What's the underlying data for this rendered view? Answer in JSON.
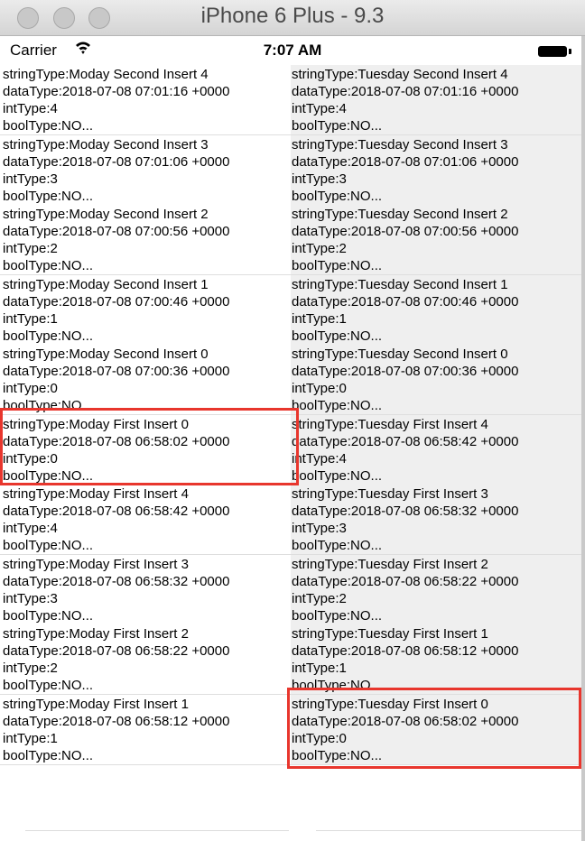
{
  "window": {
    "title": "iPhone 6 Plus - 9.3"
  },
  "statusbar": {
    "carrier": "Carrier",
    "time": "7:07 AM"
  },
  "left_column": [
    {
      "stringType": "stringType:Moday Second Insert 4",
      "dataType": "dataType:2018-07-08 07:01:16 +0000",
      "intType": "intType:4",
      "boolType": "boolType:NO..."
    },
    {
      "stringType": "stringType:Moday Second Insert 3",
      "dataType": "dataType:2018-07-08 07:01:06 +0000",
      "intType": "intType:3",
      "boolType": "boolType:NO..."
    },
    {
      "stringType": "stringType:Moday Second Insert 2",
      "dataType": "dataType:2018-07-08 07:00:56 +0000",
      "intType": "intType:2",
      "boolType": "boolType:NO..."
    },
    {
      "stringType": "stringType:Moday Second Insert 1",
      "dataType": "dataType:2018-07-08 07:00:46 +0000",
      "intType": "intType:1",
      "boolType": "boolType:NO..."
    },
    {
      "stringType": "stringType:Moday Second Insert 0",
      "dataType": "dataType:2018-07-08 07:00:36 +0000",
      "intType": "intType:0",
      "boolType": "boolType:NO..."
    },
    {
      "stringType": "stringType:Moday First Insert 0",
      "dataType": "dataType:2018-07-08 06:58:02 +0000",
      "intType": "intType:0",
      "boolType": "boolType:NO..."
    },
    {
      "stringType": "stringType:Moday First Insert 4",
      "dataType": "dataType:2018-07-08 06:58:42 +0000",
      "intType": "intType:4",
      "boolType": "boolType:NO..."
    },
    {
      "stringType": "stringType:Moday First Insert 3",
      "dataType": "dataType:2018-07-08 06:58:32 +0000",
      "intType": "intType:3",
      "boolType": "boolType:NO..."
    },
    {
      "stringType": "stringType:Moday First Insert 2",
      "dataType": "dataType:2018-07-08 06:58:22 +0000",
      "intType": "intType:2",
      "boolType": "boolType:NO..."
    },
    {
      "stringType": "stringType:Moday First Insert 1",
      "dataType": "dataType:2018-07-08 06:58:12 +0000",
      "intType": "intType:1",
      "boolType": "boolType:NO..."
    }
  ],
  "right_column": [
    {
      "stringType": "stringType:Tuesday Second Insert 4",
      "dataType": "dataType:2018-07-08 07:01:16 +0000",
      "intType": "intType:4",
      "boolType": "boolType:NO..."
    },
    {
      "stringType": "stringType:Tuesday Second Insert 3",
      "dataType": "dataType:2018-07-08 07:01:06 +0000",
      "intType": "intType:3",
      "boolType": "boolType:NO..."
    },
    {
      "stringType": "stringType:Tuesday Second Insert 2",
      "dataType": "dataType:2018-07-08 07:00:56 +0000",
      "intType": "intType:2",
      "boolType": "boolType:NO..."
    },
    {
      "stringType": "stringType:Tuesday Second Insert 1",
      "dataType": "dataType:2018-07-08 07:00:46 +0000",
      "intType": "intType:1",
      "boolType": "boolType:NO..."
    },
    {
      "stringType": "stringType:Tuesday Second Insert 0",
      "dataType": "dataType:2018-07-08 07:00:36 +0000",
      "intType": "intType:0",
      "boolType": "boolType:NO..."
    },
    {
      "stringType": "stringType:Tuesday First Insert 4",
      "dataType": "dataType:2018-07-08 06:58:42 +0000",
      "intType": "intType:4",
      "boolType": "boolType:NO..."
    },
    {
      "stringType": "stringType:Tuesday First Insert 3",
      "dataType": "dataType:2018-07-08 06:58:32 +0000",
      "intType": "intType:3",
      "boolType": "boolType:NO..."
    },
    {
      "stringType": "stringType:Tuesday First Insert 2",
      "dataType": "dataType:2018-07-08 06:58:22 +0000",
      "intType": "intType:2",
      "boolType": "boolType:NO..."
    },
    {
      "stringType": "stringType:Tuesday First Insert 1",
      "dataType": "dataType:2018-07-08 06:58:12 +0000",
      "intType": "intType:1",
      "boolType": "boolType:NO..."
    },
    {
      "stringType": "stringType:Tuesday First Insert 0",
      "dataType": "dataType:2018-07-08 06:58:02 +0000",
      "intType": "intType:0",
      "boolType": "boolType:NO..."
    }
  ],
  "highlight_color": "#e8362d"
}
